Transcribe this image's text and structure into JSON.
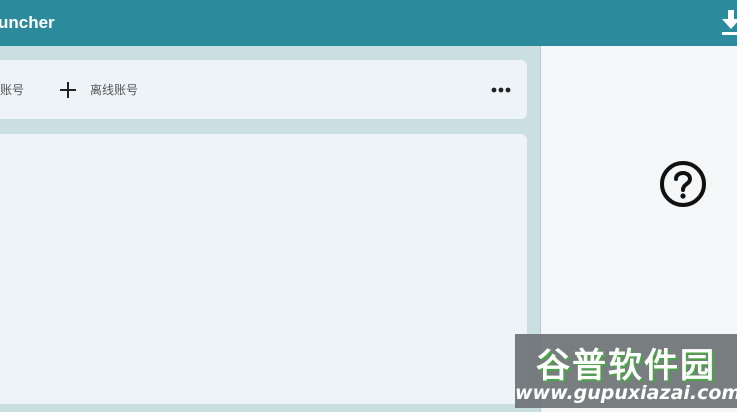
{
  "window": {
    "title": "uncher"
  },
  "toolbar": {
    "account_label": "账号",
    "add_offline_label": "离线账号",
    "more_icon": "more-horizontal-icon",
    "add_icon": "plus-icon"
  },
  "header": {
    "download_icon": "download-icon"
  },
  "right_panel": {
    "help_icon": "help-circle-icon"
  },
  "watermark": {
    "title": "谷普软件园",
    "url": "www.gupuxiazai.com"
  },
  "colors": {
    "titlebar": "#2b8a9b",
    "background": "#c9dfe2",
    "card": "#edf3f6",
    "panel": "#f4f6f7"
  }
}
